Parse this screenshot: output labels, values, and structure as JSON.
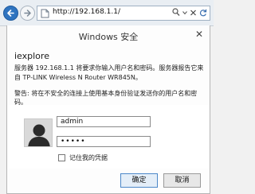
{
  "browser": {
    "url": "http://192.168.1.1/"
  },
  "dialog": {
    "title": "Windows 安全",
    "close_glyph": "✕",
    "app_name": "iexplore",
    "message": "服务器 192.168.1.1 将要求你输入用户名和密码。服务器报告它来自 TP-LINK Wireless N Router WR845N。",
    "warning": "警告: 将在不安全的连接上使用基本身份验证发送你的用户名和密码。",
    "username_value": "admin",
    "password_mask": "•••••",
    "remember_label": "记住我的凭据",
    "ok_label": "确定",
    "cancel_label": "取消"
  },
  "colors": {
    "accent": "#2f74c0",
    "dialog_bg": "#fdfdfd",
    "avatar_bg": "#d9d9d9"
  },
  "icons": [
    "back-arrow-icon",
    "forward-arrow-icon",
    "page-icon",
    "search-icon",
    "close-icon",
    "refresh-icon",
    "user-avatar-icon"
  ]
}
